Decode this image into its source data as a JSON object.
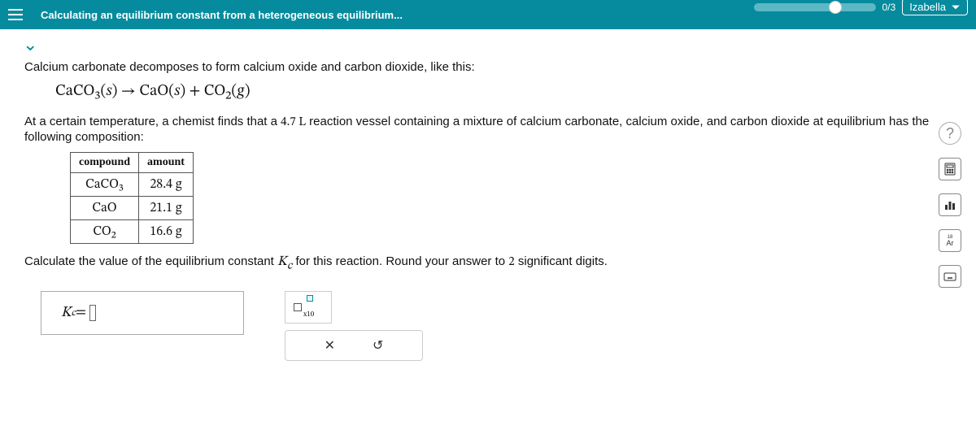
{
  "header": {
    "title": "Calculating an equilibrium constant from a heterogeneous equilibrium...",
    "progress": "0/3",
    "user": "Izabella"
  },
  "problem": {
    "line1": "Calcium carbonate decomposes to form calcium oxide and carbon dioxide, like this:",
    "equation": "CaCO₃(𝑠) → CaO(𝑠) + CO₂(𝑔)",
    "line2a": "At a certain temperature, a chemist finds that a ",
    "volume": "4.7 L",
    "line2b": " reaction vessel containing a mixture of calcium carbonate, calcium oxide, and carbon dioxide at equilibrium has the following composition:",
    "table": {
      "headers": [
        "compound",
        "amount"
      ],
      "rows": [
        {
          "compound": "CaCO₃",
          "amount": "28.4 g"
        },
        {
          "compound": "CaO",
          "amount": "21.1 g"
        },
        {
          "compound": "CO₂",
          "amount": "16.6 g"
        }
      ]
    },
    "line3a": "Calculate the value of the equilibrium constant ",
    "kc": "K",
    "kcsub": "c",
    "line3b": " for this reaction. Round your answer to ",
    "sig": "2",
    "line3c": " significant digits."
  },
  "answer": {
    "label": "K",
    "sub": "c",
    "eq": " = "
  },
  "tools": {
    "sci_label": "x10",
    "clear": "✕",
    "reset": "↺"
  },
  "side": {
    "help": "?",
    "calculator": "🖩",
    "graph": "⫴",
    "periodic": "Ar",
    "keyboard": "⌨"
  }
}
